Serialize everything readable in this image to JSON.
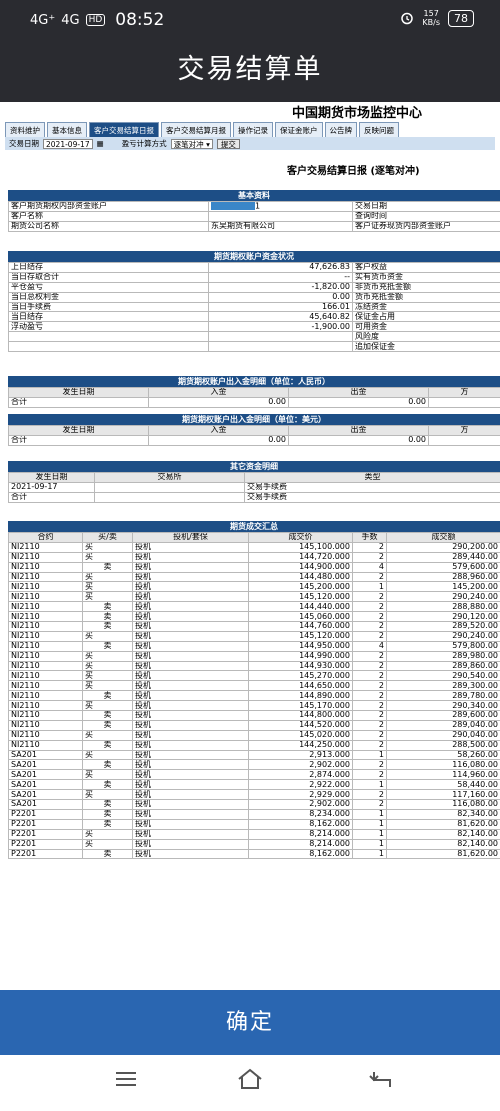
{
  "status": {
    "signal1": "4G⁺",
    "signal2": "4G",
    "hd": "HD",
    "time": "08:52",
    "speed_top": "157",
    "speed_unit": "KB/s",
    "battery": "78"
  },
  "title": "交易结算单",
  "center_title": "中国期货市场监控中心",
  "tabs": [
    "资料维护",
    "基本信息",
    "客户交易结算日报",
    "客户交易结算月报",
    "操作记录",
    "保证金账户",
    "公告牌",
    "反映问题"
  ],
  "toolbar": {
    "date_label": "交易日期",
    "date_value": "2021-09-17",
    "method_label": "盈亏计算方式",
    "method_value": "逐笔对冲 ▾",
    "submit": "提交"
  },
  "report_title": "客户交易结算日报 (逐笔对冲)",
  "basic": {
    "header": "基本资料",
    "rows": [
      [
        "客户期货期权内部资金账户",
        "1",
        "交易日期",
        ""
      ],
      [
        "客户名称",
        "",
        "查询时间",
        ""
      ],
      [
        "期货公司名称",
        "东吴期货有限公司",
        "客户证券现货内部资金账户",
        ""
      ]
    ]
  },
  "funds": {
    "header": "期货期权账户资金状况",
    "rows": [
      [
        "上日结存",
        "47,626.83",
        "客户权益"
      ],
      [
        "当日存取合计",
        "--",
        "实有货币资金"
      ],
      [
        "平仓盈亏",
        "-1,820.00",
        "非货币充抵金额"
      ],
      [
        "当日总权利金",
        "0.00",
        "货币充抵金额"
      ],
      [
        "当日手续费",
        "166.01",
        "冻结资金"
      ],
      [
        "当日结存",
        "45,640.82",
        "保证金占用"
      ],
      [
        "浮动盈亏",
        "-1,900.00",
        "可用资金"
      ],
      [
        "",
        "",
        "风险度"
      ],
      [
        "",
        "",
        "追加保证金"
      ]
    ]
  },
  "inout_rmb": {
    "header": "期货期权账户出入金明细（单位：人民币）",
    "cols": [
      "发生日期",
      "入金",
      "出金",
      "方"
    ],
    "total": [
      "合计",
      "0.00",
      "0.00"
    ]
  },
  "inout_usd": {
    "header": "期货期权账户出入金明细（单位：美元）",
    "cols": [
      "发生日期",
      "入金",
      "出金",
      "方"
    ],
    "total": [
      "合计",
      "0.00",
      "0.00"
    ]
  },
  "other": {
    "header": "其它资金明细",
    "cols": [
      "发生日期",
      "交易所",
      "类型"
    ],
    "rows": [
      [
        "2021-09-17",
        "",
        "交易手续费"
      ],
      [
        "合计",
        "",
        "交易手续费"
      ]
    ]
  },
  "trades": {
    "header": "期货成交汇总",
    "cols": [
      "合约",
      "买/卖",
      "投机/套保",
      "成交价",
      "手数",
      "成交额"
    ],
    "rows": [
      [
        "NI2110",
        "买",
        "投机",
        "145,100.000",
        "2",
        "290,200.00"
      ],
      [
        "NI2110",
        "买",
        "投机",
        "144,720.000",
        "2",
        "289,440.00"
      ],
      [
        "NI2110",
        "卖",
        "投机",
        "144,900.000",
        "4",
        "579,600.00"
      ],
      [
        "NI2110",
        "买",
        "投机",
        "144,480.000",
        "2",
        "288,960.00"
      ],
      [
        "NI2110",
        "买",
        "投机",
        "145,200.000",
        "1",
        "145,200.00"
      ],
      [
        "NI2110",
        "买",
        "投机",
        "145,120.000",
        "2",
        "290,240.00"
      ],
      [
        "NI2110",
        "卖",
        "投机",
        "144,440.000",
        "2",
        "288,880.00"
      ],
      [
        "NI2110",
        "卖",
        "投机",
        "145,060.000",
        "2",
        "290,120.00"
      ],
      [
        "NI2110",
        "卖",
        "投机",
        "144,760.000",
        "2",
        "289,520.00"
      ],
      [
        "NI2110",
        "买",
        "投机",
        "145,120.000",
        "2",
        "290,240.00"
      ],
      [
        "NI2110",
        "卖",
        "投机",
        "144,950.000",
        "4",
        "579,800.00"
      ],
      [
        "NI2110",
        "买",
        "投机",
        "144,990.000",
        "2",
        "289,980.00"
      ],
      [
        "NI2110",
        "买",
        "投机",
        "144,930.000",
        "2",
        "289,860.00"
      ],
      [
        "NI2110",
        "买",
        "投机",
        "145,270.000",
        "2",
        "290,540.00"
      ],
      [
        "NI2110",
        "买",
        "投机",
        "144,650.000",
        "2",
        "289,300.00"
      ],
      [
        "NI2110",
        "卖",
        "投机",
        "144,890.000",
        "2",
        "289,780.00"
      ],
      [
        "NI2110",
        "买",
        "投机",
        "145,170.000",
        "2",
        "290,340.00"
      ],
      [
        "NI2110",
        "卖",
        "投机",
        "144,800.000",
        "2",
        "289,600.00"
      ],
      [
        "NI2110",
        "卖",
        "投机",
        "144,520.000",
        "2",
        "289,040.00"
      ],
      [
        "NI2110",
        "买",
        "投机",
        "145,020.000",
        "2",
        "290,040.00"
      ],
      [
        "NI2110",
        "卖",
        "投机",
        "144,250.000",
        "2",
        "288,500.00"
      ],
      [
        "SA201",
        "买",
        "投机",
        "2,913.000",
        "1",
        "58,260.00"
      ],
      [
        "SA201",
        "卖",
        "投机",
        "2,902.000",
        "2",
        "116,080.00"
      ],
      [
        "SA201",
        "买",
        "投机",
        "2,874.000",
        "2",
        "114,960.00"
      ],
      [
        "SA201",
        "卖",
        "投机",
        "2,922.000",
        "1",
        "58,440.00"
      ],
      [
        "SA201",
        "买",
        "投机",
        "2,929.000",
        "2",
        "117,160.00"
      ],
      [
        "SA201",
        "卖",
        "投机",
        "2,902.000",
        "2",
        "116,080.00"
      ],
      [
        "P2201",
        "卖",
        "投机",
        "8,234.000",
        "1",
        "82,340.00"
      ],
      [
        "P2201",
        "卖",
        "投机",
        "8,162.000",
        "1",
        "81,620.00"
      ],
      [
        "P2201",
        "买",
        "投机",
        "8,214.000",
        "1",
        "82,140.00"
      ],
      [
        "P2201",
        "买",
        "投机",
        "8,214.000",
        "1",
        "82,140.00"
      ],
      [
        "P2201",
        "卖",
        "投机",
        "8,162.000",
        "1",
        "81,620.00"
      ]
    ]
  },
  "confirm": "确定",
  "nav": {
    "menu": "menu-icon",
    "home": "home-icon",
    "back": "back-icon"
  }
}
